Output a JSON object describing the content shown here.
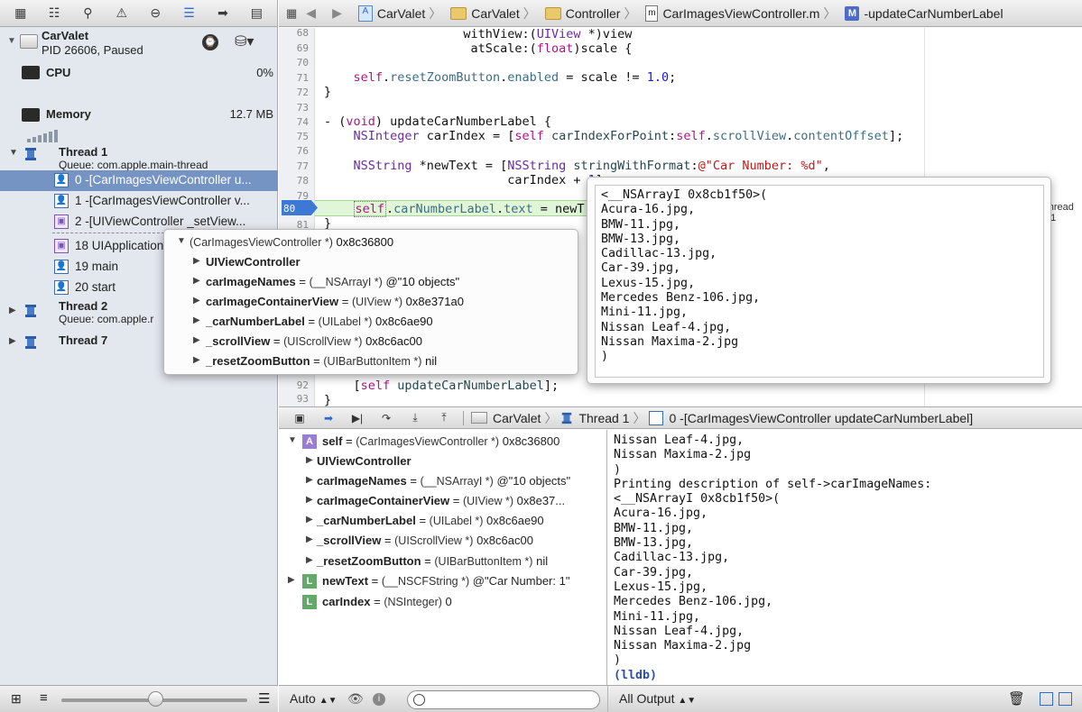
{
  "navigator": {
    "toolbar_icons": [
      "project-navigator-icon",
      "symbol-navigator-icon",
      "find-icon",
      "issue-icon",
      "test-icon",
      "debug-navigator-icon",
      "breakpoint-icon",
      "log-icon"
    ],
    "process": {
      "name": "CarValet",
      "status": "PID 26606, Paused"
    },
    "gauges": {
      "cpu": {
        "label": "CPU",
        "value": "0%"
      },
      "memory": {
        "label": "Memory",
        "value": "12.7 MB"
      }
    },
    "threads": [
      {
        "name": "Thread 1",
        "queue": "Queue: com.apple.main-thread"
      },
      {
        "name": "Thread 2",
        "queue": "Queue: com.apple.r"
      },
      {
        "name": "Thread 7",
        "queue": ""
      }
    ],
    "frames": [
      {
        "label": "0 -[CarImagesViewController u...",
        "selected": true
      },
      {
        "label": "1 -[CarImagesViewController v...",
        "selected": false
      },
      {
        "label": "2 -[UIViewController _setView...",
        "selected": false
      },
      {
        "label": "18 UIApplication",
        "selected": false
      },
      {
        "label": "19 main",
        "selected": false
      },
      {
        "label": "20 start",
        "selected": false
      }
    ]
  },
  "jumpbar": {
    "items": [
      "CarValet",
      "CarValet",
      "Controller",
      "CarImagesViewController.m",
      "-updateCarNumberLabel"
    ]
  },
  "editor": {
    "line_numbers": [
      "68",
      "69",
      "70",
      "71",
      "72",
      "73",
      "74",
      "75",
      "76",
      "77",
      "78",
      "79",
      "80",
      "81",
      "92",
      "93"
    ],
    "current_line": "80",
    "thread_tag": "Thread 3.1"
  },
  "variable_popover": {
    "header": {
      "type": "(CarImagesViewController *)",
      "value": "0x8c36800"
    },
    "rows": [
      {
        "name": "UIViewController",
        "type": "",
        "value": ""
      },
      {
        "name": "carImageNames",
        "type": "(__NSArrayI *)",
        "value": "@\"10 objects\""
      },
      {
        "name": "carImageContainerView",
        "type": "(UIView *)",
        "value": "0x8e371a0"
      },
      {
        "name": "_carNumberLabel",
        "type": "(UILabel *)",
        "value": "0x8c6ae90"
      },
      {
        "name": "_scrollView",
        "type": "(UIScrollView *)",
        "value": "0x8c6ac00"
      },
      {
        "name": "_resetZoomButton",
        "type": "(UIBarButtonItem *)",
        "value": "nil"
      }
    ]
  },
  "description_popover": {
    "lines": [
      "<__NSArrayI 0x8cb1f50>(",
      "Acura-16.jpg,",
      "BMW-11.jpg,",
      "BMW-13.jpg,",
      "Cadillac-13.jpg,",
      "Car-39.jpg,",
      "Lexus-15.jpg,",
      "Mercedes Benz-106.jpg,",
      "Mini-11.jpg,",
      "Nissan Leaf-4.jpg,",
      "Nissan Maxima-2.jpg",
      ")"
    ]
  },
  "debugbar": {
    "process": "CarValet",
    "thread": "Thread 1",
    "frame": "0 -[CarImagesViewController updateCarNumberLabel]"
  },
  "variables": [
    {
      "badge": "A",
      "name": "self",
      "type": "(CarImagesViewController *)",
      "value": "0x8c36800",
      "indent": 0
    },
    {
      "badge": "",
      "name": "UIViewController",
      "type": "",
      "value": "",
      "indent": 1
    },
    {
      "badge": "",
      "name": "carImageNames",
      "type": "(__NSArrayI *)",
      "value": "@\"10 objects\"",
      "indent": 1
    },
    {
      "badge": "",
      "name": "carImageContainerView",
      "type": "(UIView *)",
      "value": "0x8e37...",
      "indent": 1
    },
    {
      "badge": "",
      "name": "_carNumberLabel",
      "type": "(UILabel *)",
      "value": "0x8c6ae90",
      "indent": 1
    },
    {
      "badge": "",
      "name": "_scrollView",
      "type": "(UIScrollView *)",
      "value": "0x8c6ac00",
      "indent": 1
    },
    {
      "badge": "",
      "name": "_resetZoomButton",
      "type": "(UIBarButtonItem *)",
      "value": "nil",
      "indent": 1
    },
    {
      "badge": "L",
      "name": "newText",
      "type": "(__NSCFString *)",
      "value": "@\"Car Number: 1\"",
      "indent": 0
    },
    {
      "badge": "L",
      "name": "carIndex",
      "type": "(NSInteger)",
      "value": "0",
      "indent": 0
    }
  ],
  "console": {
    "lines": [
      "Nissan Leaf-4.jpg,",
      "Nissan Maxima-2.jpg",
      ")",
      "Printing description of self->carImageNames:",
      "<__NSArrayI 0x8cb1f50>(",
      "Acura-16.jpg,",
      "BMW-11.jpg,",
      "BMW-13.jpg,",
      "Cadillac-13.jpg,",
      "Car-39.jpg,",
      "Lexus-15.jpg,",
      "Mercedes Benz-106.jpg,",
      "Mini-11.jpg,",
      "Nissan Leaf-4.jpg,",
      "Nissan Maxima-2.jpg",
      ")"
    ],
    "prompt": "(lldb)"
  },
  "bottombar": {
    "scope": "Auto",
    "output": "All Output"
  }
}
